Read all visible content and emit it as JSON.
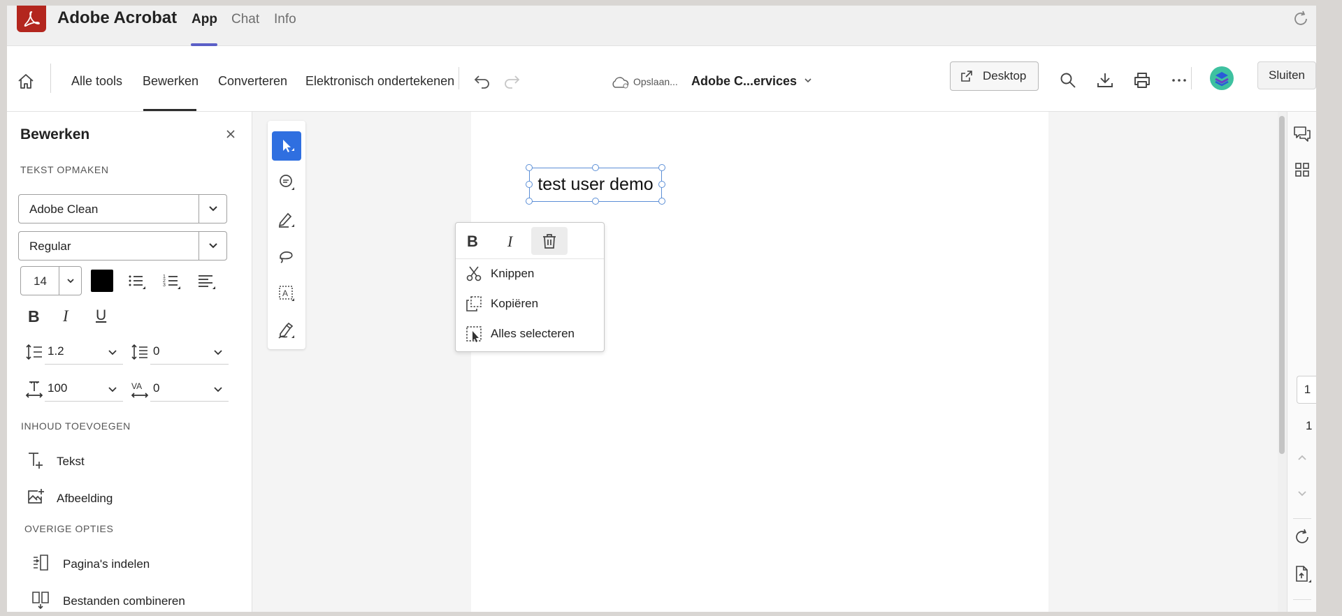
{
  "app": {
    "title": "Adobe Acrobat",
    "tabs": [
      {
        "label": "App",
        "active": true
      },
      {
        "label": "Chat",
        "active": false
      },
      {
        "label": "Info",
        "active": false
      }
    ],
    "accent_color": "#5b5fc7",
    "logo_color": "#b3261e"
  },
  "toolbar": {
    "items": [
      "Alle tools",
      "Bewerken",
      "Converteren",
      "Elektronisch ondertekenen"
    ],
    "active_item": "Bewerken",
    "saving_status": "Opslaan...",
    "document_name": "Adobe C...ervices",
    "desktop_label": "Desktop",
    "close_label": "Sluiten"
  },
  "left_panel": {
    "title": "Bewerken",
    "format_section": "TEKST OPMAKEN",
    "font_family": "Adobe Clean",
    "font_style": "Regular",
    "font_size": "14",
    "text_color": "#000000",
    "bold_label": "B",
    "italic_label": "I",
    "underline_label": "U",
    "line_spacing": "1.2",
    "paragraph_spacing": "0",
    "horizontal_scale": "100",
    "char_spacing": "0",
    "add_content_section": "INHOUD TOEVOEGEN",
    "add_text": "Tekst",
    "add_image": "Afbeelding",
    "other_section": "OVERIGE OPTIES",
    "organize_pages": "Pagina's indelen",
    "combine_files": "Bestanden combineren"
  },
  "canvas": {
    "textbox_content": "test user demo",
    "selection_color": "#5c8fd6"
  },
  "context_menu": {
    "bold_label": "B",
    "italic_label": "I",
    "items": [
      "Knippen",
      "Kopiëren",
      "Alles selecteren"
    ]
  },
  "right_rail": {
    "current_page": "1",
    "total_pages": "1"
  }
}
